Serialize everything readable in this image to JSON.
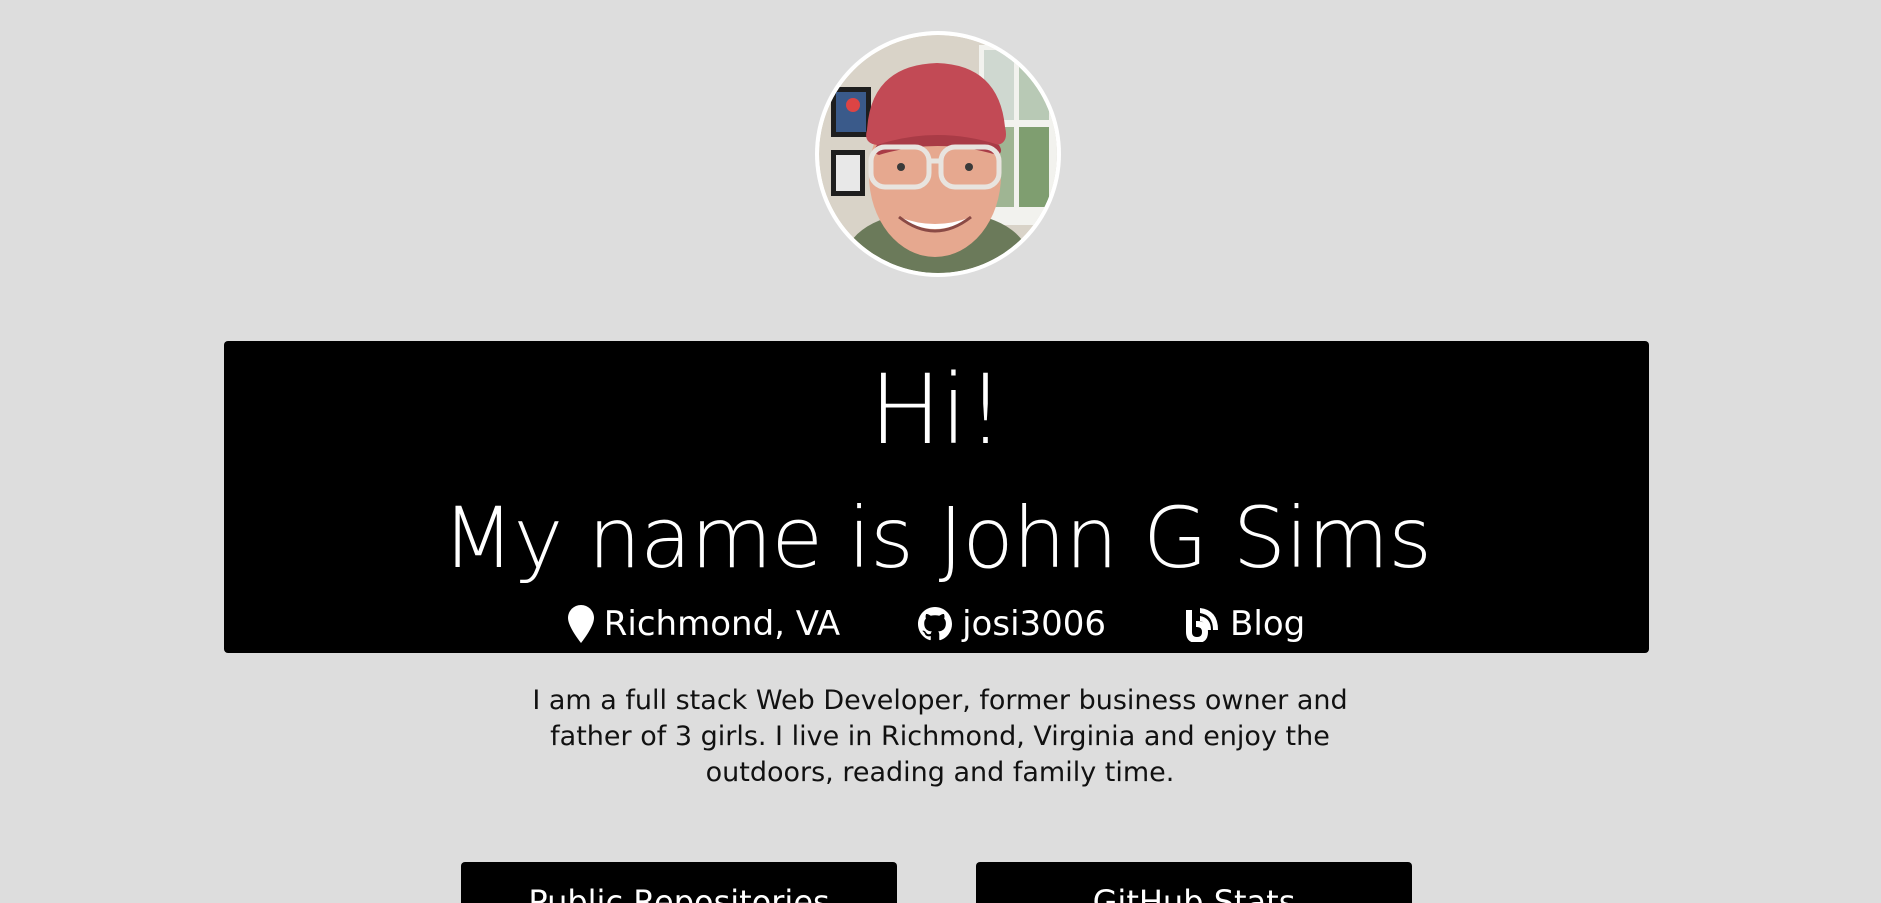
{
  "hero": {
    "greeting": "Hi!",
    "name_line": "My name is John G Sims",
    "location": "Richmond, VA",
    "github_handle": "josi3006",
    "blog_label": "Blog"
  },
  "bio": "I am a full stack Web Developer, former business owner and father of 3 girls. I live in Richmond, Virginia and enjoy the outdoors, reading and family time.",
  "buttons": {
    "public_repos": "Public Repositories",
    "github_stats": "GitHub Stats"
  },
  "icons": {
    "location": "map-pin-icon",
    "github": "github-icon",
    "blog": "blog-icon"
  },
  "colors": {
    "background": "#dddddd",
    "panel": "#000000",
    "panel_text": "#ffffff",
    "body_text": "#111111"
  }
}
